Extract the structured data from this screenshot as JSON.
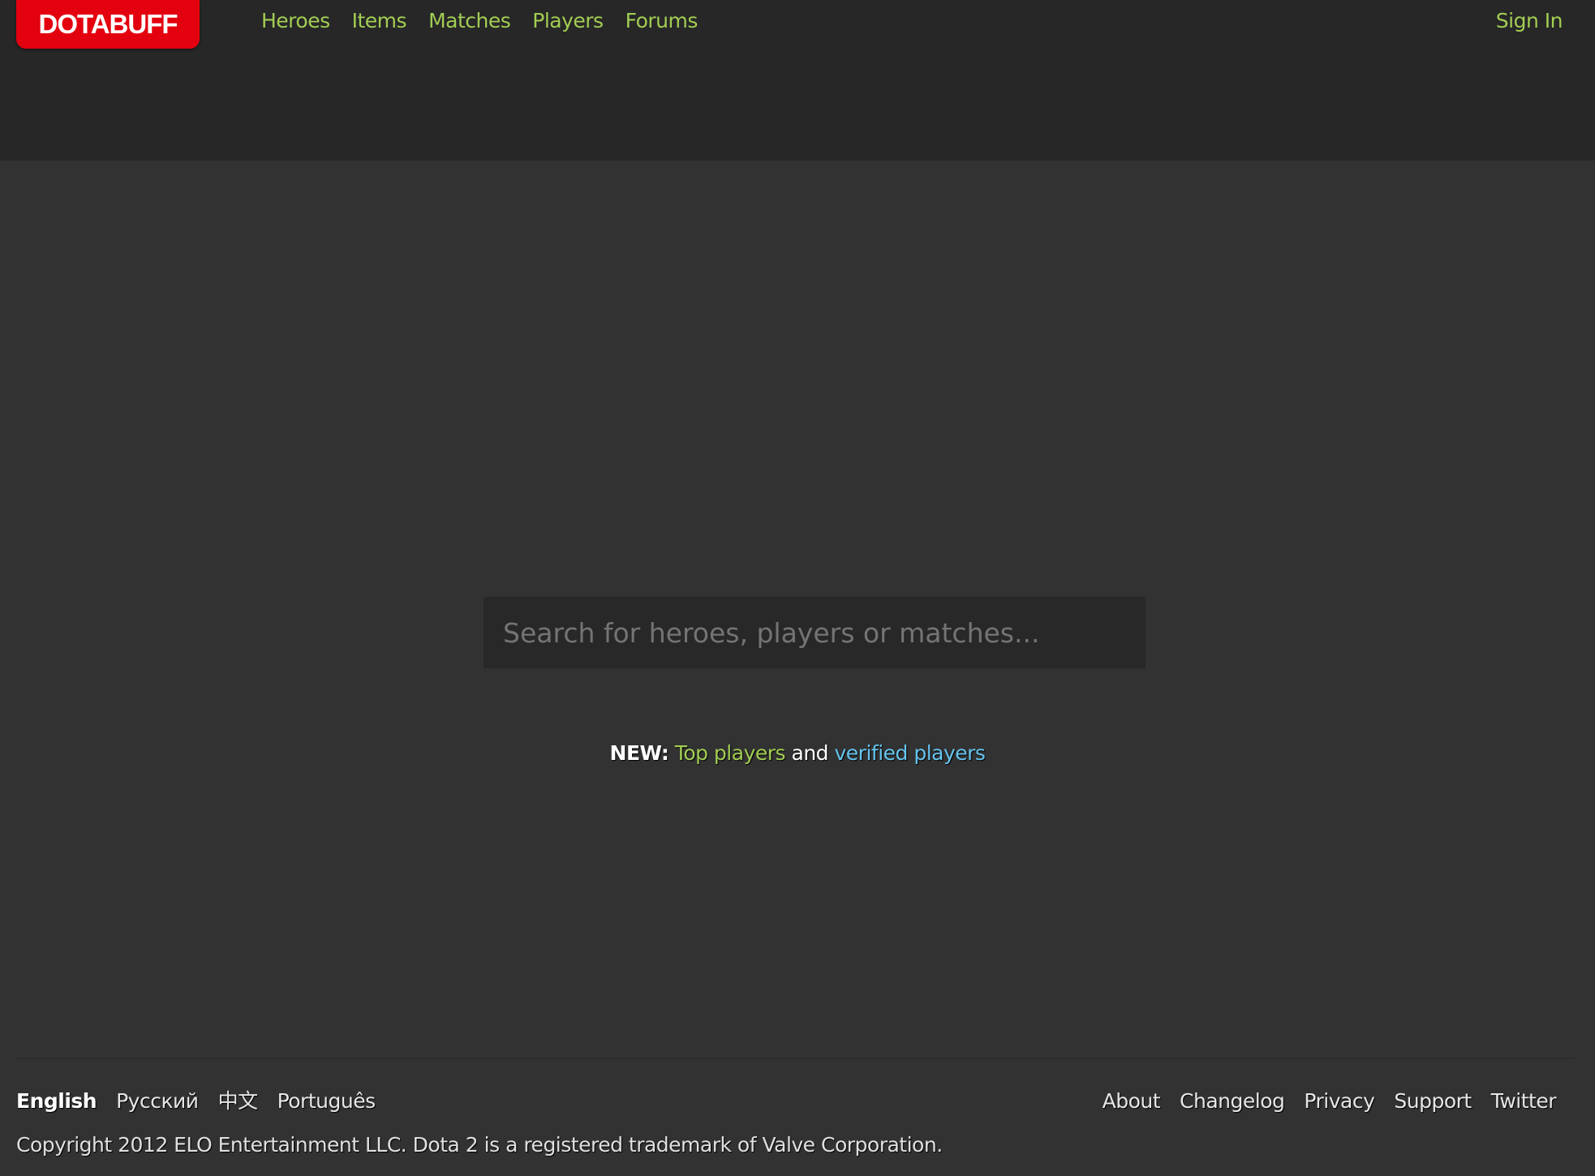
{
  "header": {
    "logo": "DOTABUFF",
    "nav": [
      {
        "label": "Heroes"
      },
      {
        "label": "Items"
      },
      {
        "label": "Matches"
      },
      {
        "label": "Players"
      },
      {
        "label": "Forums"
      }
    ],
    "sign_in": "Sign In"
  },
  "search": {
    "placeholder": "Search for heroes, players or matches...",
    "value": ""
  },
  "news": {
    "prefix": "NEW:",
    "link1": "Top players",
    "conjunction": "and",
    "link2": "verified players"
  },
  "footer": {
    "languages": [
      {
        "label": "English",
        "active": true
      },
      {
        "label": "Русский"
      },
      {
        "label": "中文"
      },
      {
        "label": "Português"
      }
    ],
    "links": [
      {
        "label": "About"
      },
      {
        "label": "Changelog"
      },
      {
        "label": "Privacy"
      },
      {
        "label": "Support"
      },
      {
        "label": "Twitter"
      }
    ],
    "copyright": "Copyright 2012 ELO Entertainment LLC. Dota 2 is a registered trademark of Valve Corporation."
  },
  "colors": {
    "brand": "#e3000f",
    "link_green": "#a2cd53",
    "link_blue": "#66c4ee",
    "background": "#323232",
    "header_background": "#272727"
  }
}
